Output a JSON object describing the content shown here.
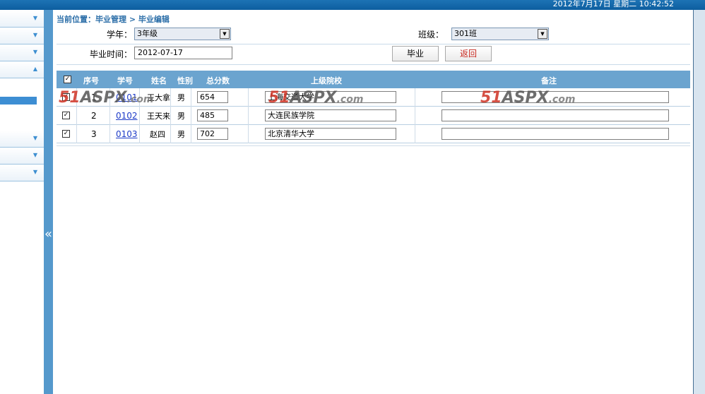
{
  "header": {
    "datetime": "2012年7月17日 星期二 10:42:52"
  },
  "sidebar": {
    "collapse_glyph": "«"
  },
  "breadcrumb": "当前位置：毕业管理 > 毕业编辑",
  "form": {
    "year_label": "学年：",
    "year_value": "3年级",
    "class_label": "班级：",
    "class_value": "301班",
    "date_label": "毕业时间：",
    "date_value": "2012-07-17",
    "graduate_button": "毕业",
    "return_button": "返回"
  },
  "table": {
    "columns": [
      "序号",
      "学号",
      "姓名",
      "性别",
      "总分数",
      "上级院校",
      "备注"
    ],
    "rows": [
      {
        "seq": "1",
        "id": "0101",
        "name": "王大拿",
        "gender": "男",
        "score": "654",
        "school": "上海交通大学",
        "remark": ""
      },
      {
        "seq": "2",
        "id": "0102",
        "name": "王天来",
        "gender": "男",
        "score": "485",
        "school": "大连民族学院",
        "remark": ""
      },
      {
        "seq": "3",
        "id": "0103",
        "name": "赵四",
        "gender": "男",
        "score": "702",
        "school": "北京清华大学",
        "remark": ""
      }
    ]
  },
  "watermark": {
    "brand": "51",
    "brand2": "ASPX",
    "suffix": ".com"
  },
  "colors": {
    "accent": "#6ba4cf",
    "link": "#1e3cc8",
    "return": "#c8281e"
  }
}
